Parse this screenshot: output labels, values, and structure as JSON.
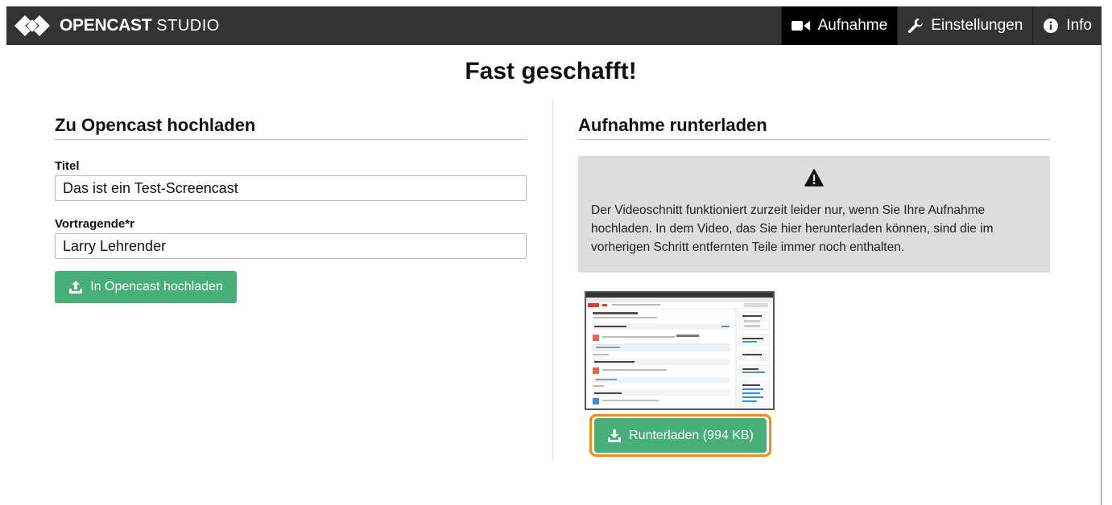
{
  "header": {
    "brand_name": "OPENCAST",
    "brand_sub": "STUDIO",
    "nav": [
      {
        "label": "Aufnahme",
        "icon": "video-camera-icon",
        "active": true
      },
      {
        "label": "Einstellungen",
        "icon": "wrench-icon",
        "active": false
      },
      {
        "label": "Info",
        "icon": "info-circle-icon",
        "active": false
      }
    ]
  },
  "page": {
    "title": "Fast geschafft!"
  },
  "upload": {
    "heading": "Zu Opencast hochladen",
    "title_label": "Titel",
    "title_value": "Das ist ein Test-Screencast",
    "presenter_label": "Vortragende*r",
    "presenter_value": "Larry Lehrender",
    "button_label": "In Opencast hochladen",
    "button_icon": "upload-icon"
  },
  "download": {
    "heading": "Aufnahme runterladen",
    "warning_icon": "warning-triangle-icon",
    "warning_text": "Der Videoschnitt funktioniert zurzeit leider nur, wenn Sie Ihre Aufnahme hochladen. In dem Video, das Sie hier herunterladen können, sind die im vorherigen Schritt entfernten Teile immer noch enthalten.",
    "button_label": "Runterladen (994 KB)",
    "button_icon": "download-icon"
  },
  "colors": {
    "topbar": "#333333",
    "active_tab": "#000000",
    "button_green": "#47af7a",
    "focus_ring": "#ff8a00",
    "warning_bg": "#dddddd"
  }
}
